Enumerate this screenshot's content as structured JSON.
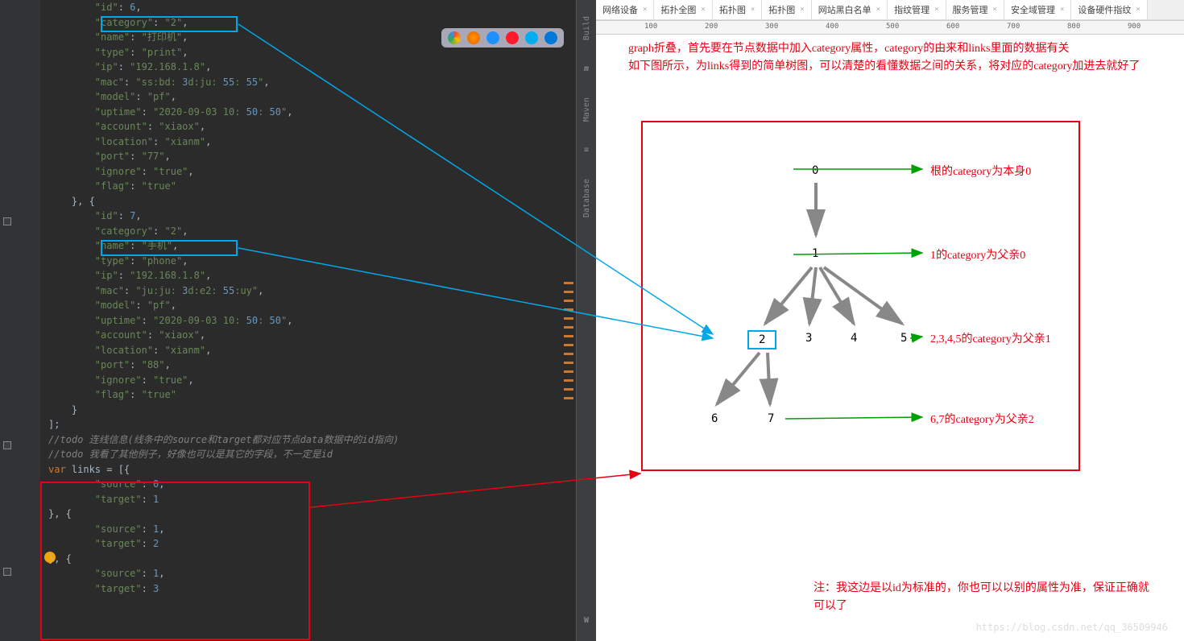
{
  "sidebar_tools": [
    "Build",
    "Maven",
    "Database"
  ],
  "browser_tabs": [
    "网络设备",
    "拓扑全图",
    "拓扑图",
    "拓扑图",
    "网站黑白名单",
    "指纹管理",
    "服务管理",
    "安全域管理",
    "设备硬件指纹"
  ],
  "ruler_ticks": [
    "100",
    "200",
    "300",
    "400",
    "500",
    "600",
    "700",
    "800",
    "900"
  ],
  "code_lines": [
    {
      "txt": "        \"id\":6,",
      "type": "json"
    },
    {
      "txt": "        \"category\": \"2\",",
      "type": "json",
      "hl": "cyan1"
    },
    {
      "txt": "        \"name\": \"打印机\",",
      "type": "json"
    },
    {
      "txt": "        \"type\": \"print\",",
      "type": "json"
    },
    {
      "txt": "        \"ip\":\"192.168.1.8\",",
      "type": "json"
    },
    {
      "txt": "        \"mac\":\"ss:bd:3d:ju:55:55\",",
      "type": "json"
    },
    {
      "txt": "        \"model\":\"pf\",",
      "type": "json"
    },
    {
      "txt": "        \"uptime\":\"2020-09-03 10:50:50\",",
      "type": "json"
    },
    {
      "txt": "        \"account\":\"xiaox\",",
      "type": "json"
    },
    {
      "txt": "        \"location\":\"xianm\",",
      "type": "json"
    },
    {
      "txt": "        \"port\":\"77\",",
      "type": "json"
    },
    {
      "txt": "        \"ignore\":\"true\",",
      "type": "json"
    },
    {
      "txt": "        \"flag\":\"true\"",
      "type": "json"
    },
    {
      "txt": "    }, {",
      "type": "plain"
    },
    {
      "txt": "        \"id\": 7,",
      "type": "json"
    },
    {
      "txt": "        \"category\": \"2\",",
      "type": "json",
      "hl": "cyan2"
    },
    {
      "txt": "        \"name\": \"手机\",",
      "type": "json"
    },
    {
      "txt": "        \"type\": \"phone\",",
      "type": "json"
    },
    {
      "txt": "        \"ip\":\"192.168.1.8\",",
      "type": "json"
    },
    {
      "txt": "        \"mac\":\"ju:ju:3d:e2:55:uy\",",
      "type": "json"
    },
    {
      "txt": "        \"model\":\"pf\",",
      "type": "json"
    },
    {
      "txt": "        \"uptime\":\"2020-09-03 10:50:50\",",
      "type": "json"
    },
    {
      "txt": "        \"account\":\"xiaox\",",
      "type": "json"
    },
    {
      "txt": "        \"location\":\"xianm\",",
      "type": "json"
    },
    {
      "txt": "        \"port\":\"88\",",
      "type": "json"
    },
    {
      "txt": "        \"ignore\":\"true\",",
      "type": "json"
    },
    {
      "txt": "        \"flag\":\"true\"",
      "type": "json"
    },
    {
      "txt": "    }",
      "type": "plain"
    },
    {
      "txt": "];",
      "type": "plain"
    },
    {
      "txt": "//todo 连线信息(线条中的source和target都对应节点data数据中的id指向)",
      "type": "comment"
    },
    {
      "txt": "//todo 我看了其他例子，好像也可以是其它的字段，不一定是id",
      "type": "comment"
    },
    {
      "txt": "var links = [{",
      "type": "var"
    },
    {
      "txt": "        \"source\": 0,",
      "type": "json"
    },
    {
      "txt": "        \"target\": 1",
      "type": "json"
    },
    {
      "txt": "}, {",
      "type": "plain"
    },
    {
      "txt": "        \"source\": 1,",
      "type": "json"
    },
    {
      "txt": "        \"target\": 2",
      "type": "json"
    },
    {
      "txt": "}, {",
      "type": "plain"
    },
    {
      "txt": "        \"source\": 1,",
      "type": "json"
    },
    {
      "txt": "        \"target\": 3",
      "type": "json"
    }
  ],
  "description_lines": [
    "graph折叠，首先要在节点数据中加入category属性，category的由来和links里面的数据有关",
    "如下图所示，为links得到的简单树图，可以清楚的看懂数据之间的关系，将对应的category加进去就好了"
  ],
  "tree": {
    "nodes": {
      "n0": "0",
      "n1": "1",
      "n2": "2",
      "n3": "3",
      "n4": "4",
      "n5": "5",
      "n6": "6",
      "n7": "7"
    }
  },
  "annotations": {
    "a0": "根的category为本身0",
    "a1": "1的category为父亲0",
    "a2": "2,3,4,5的category为父亲1",
    "a3": "6,7的category为父亲2"
  },
  "note_lines": [
    "注：我这边是以id为标准的，你也可以以别的属性为准，保证正确就可以了"
  ],
  "watermark": "https://blog.csdn.net/qq_36509946"
}
